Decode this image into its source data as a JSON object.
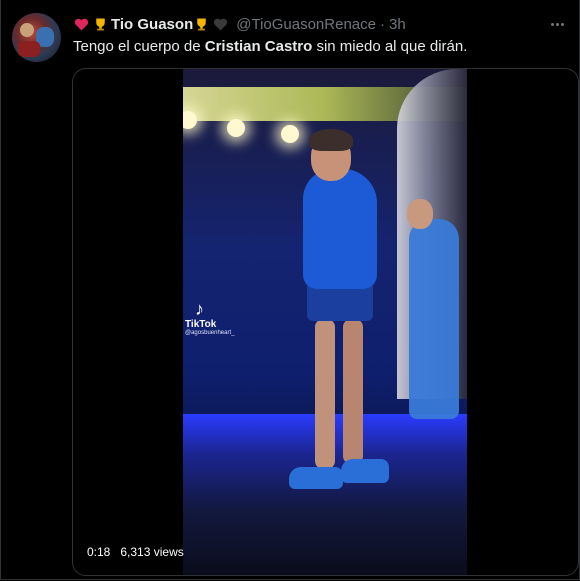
{
  "tweet": {
    "display_name": "Tio Guason",
    "handle": "@TioGuasonRenace",
    "separator": "·",
    "time": "3h",
    "text_before": "Tengo el cuerpo de ",
    "text_bold": "Cristian Castro",
    "text_after": " sin miedo al que dirán."
  },
  "name_emojis": [
    "red-heart-icon",
    "trophy-icon",
    "trophy-icon",
    "black-heart-icon"
  ],
  "media": {
    "watermark_brand": "TikTok",
    "watermark_user": "@agosbuenheart_",
    "elapsed_time": "0:18",
    "views": "6,313 views"
  },
  "colors": {
    "background": "#000000",
    "text_primary": "#e7e9ea",
    "text_secondary": "#71767b",
    "border": "#2f3336"
  }
}
